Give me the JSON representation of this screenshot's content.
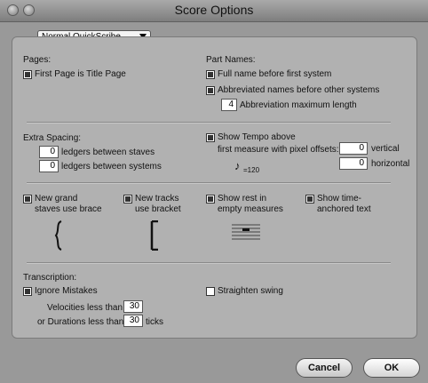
{
  "window": {
    "title": "Score Options"
  },
  "preset": {
    "selected": "Normal QuickScribe"
  },
  "pages": {
    "heading": "Pages:",
    "first_page_title": "First Page is Title Page"
  },
  "part_names": {
    "heading": "Part Names:",
    "full_name": "Full name before first system",
    "abbrev_names": "Abbreviated names before other systems",
    "abbrev_max_value": "4",
    "abbrev_max_label": "Abbreviation maximum length"
  },
  "extra_spacing": {
    "heading": "Extra Spacing:",
    "staves_value": "0",
    "staves_label": "ledgers between staves",
    "systems_value": "0",
    "systems_label": "ledgers between systems"
  },
  "tempo": {
    "show_label": "Show Tempo above",
    "first_measure_label": "first measure with pixel offsets:",
    "vertical_value": "0",
    "vertical_label": "vertical",
    "horizontal_value": "0",
    "horizontal_label": "horizontal",
    "sample": "=120"
  },
  "options": {
    "grand_line1": "New grand",
    "grand_line2": "staves use brace",
    "tracks_line1": "New tracks",
    "tracks_line2": "use bracket",
    "rest_line1": "Show rest in",
    "rest_line2": "empty measures",
    "time_line1": "Show time-",
    "time_line2": "anchored text"
  },
  "transcription": {
    "heading": "Transcription:",
    "ignore_mistakes": "Ignore Mistakes",
    "straighten_swing": "Straighten swing",
    "velocities_label": "Velocities less than",
    "velocities_value": "30",
    "durations_label": "or Durations less than",
    "durations_value": "30",
    "ticks_label": "ticks"
  },
  "buttons": {
    "cancel": "Cancel",
    "ok": "OK"
  }
}
